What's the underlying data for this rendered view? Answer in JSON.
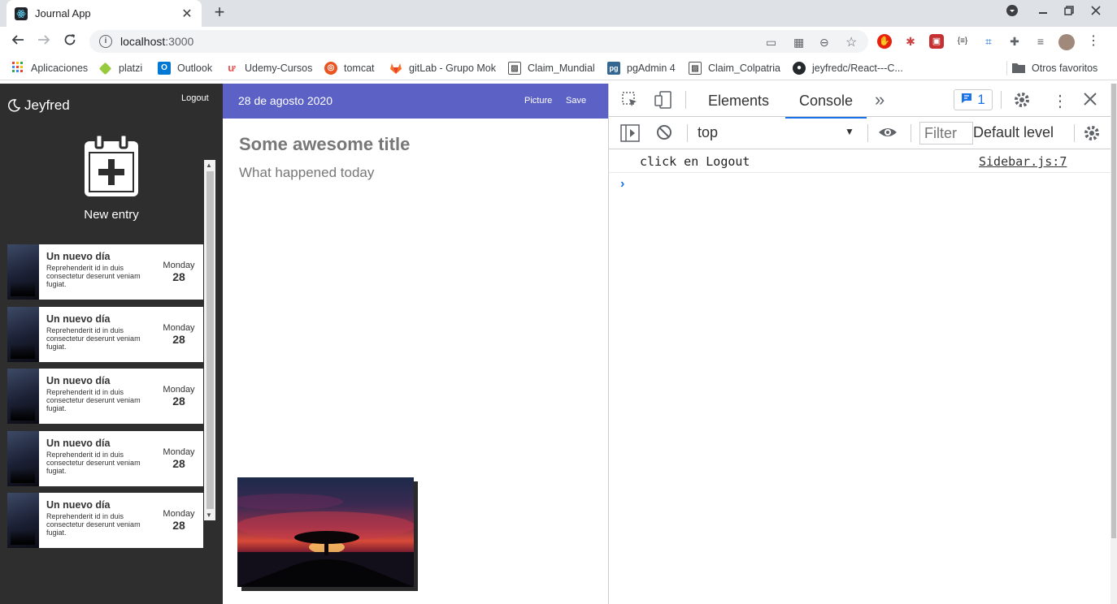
{
  "browser": {
    "tab_title": "Journal App",
    "tab_close": "✕",
    "new_tab": "+",
    "url_host": "localhost",
    "url_port": ":3000",
    "info_icon": "i",
    "bookmarks": [
      {
        "label": "Aplicaciones",
        "icon": "apps-grid-icon"
      },
      {
        "label": "platzi",
        "icon": "platzi-icon"
      },
      {
        "label": "Outlook",
        "icon": "outlook-icon"
      },
      {
        "label": "Udemy-Cursos",
        "icon": "udemy-icon"
      },
      {
        "label": "tomcat",
        "icon": "ubuntu-icon"
      },
      {
        "label": "gitLab - Grupo Mok",
        "icon": "gitlab-icon"
      },
      {
        "label": "Claim_Mundial",
        "icon": "image-icon"
      },
      {
        "label": "pgAdmin 4",
        "icon": "pg-icon"
      },
      {
        "label": "Claim_Colpatria",
        "icon": "image-icon"
      },
      {
        "label": "jeyfredc/React---C...",
        "icon": "github-icon"
      },
      {
        "label": "Otros favoritos",
        "icon": "folder-icon"
      }
    ],
    "bookmark_icon_text": {
      "outlook": "O",
      "pg": "pg"
    }
  },
  "sidebar": {
    "brand": "Jeyfred",
    "logout_label": "Logout",
    "new_entry_label": "New entry",
    "entries": [
      {
        "title": "Un nuevo día",
        "text": "Reprehenderit id in duis consectetur deserunt veniam fugiat.",
        "day": "Monday",
        "num": "28"
      },
      {
        "title": "Un nuevo día",
        "text": "Reprehenderit id in duis consectetur deserunt veniam fugiat.",
        "day": "Monday",
        "num": "28"
      },
      {
        "title": "Un nuevo día",
        "text": "Reprehenderit id in duis consectetur deserunt veniam fugiat.",
        "day": "Monday",
        "num": "28"
      },
      {
        "title": "Un nuevo día",
        "text": "Reprehenderit id in duis consectetur deserunt veniam fugiat.",
        "day": "Monday",
        "num": "28"
      },
      {
        "title": "Un nuevo día",
        "text": "Reprehenderit id in duis consectetur deserunt veniam fugiat.",
        "day": "Monday",
        "num": "28"
      }
    ]
  },
  "note": {
    "date": "28 de agosto 2020",
    "picture_label": "Picture",
    "save_label": "Save",
    "title_placeholder": "Some awesome title",
    "body_placeholder": "What happened today"
  },
  "devtools": {
    "tabs": [
      "Elements",
      "Console"
    ],
    "active_tab": "Console",
    "more_tabs": "»",
    "issues_count": "1",
    "context": "top",
    "filter_placeholder": "Filter",
    "default_level": "Default level",
    "log": {
      "message": "click en Logout",
      "source": "Sidebar.js:7"
    },
    "prompt": "›"
  },
  "colors": {
    "appbar": "#5c62c5",
    "sidebar": "#2e2e2e",
    "devtools_accent": "#1a73e8"
  }
}
